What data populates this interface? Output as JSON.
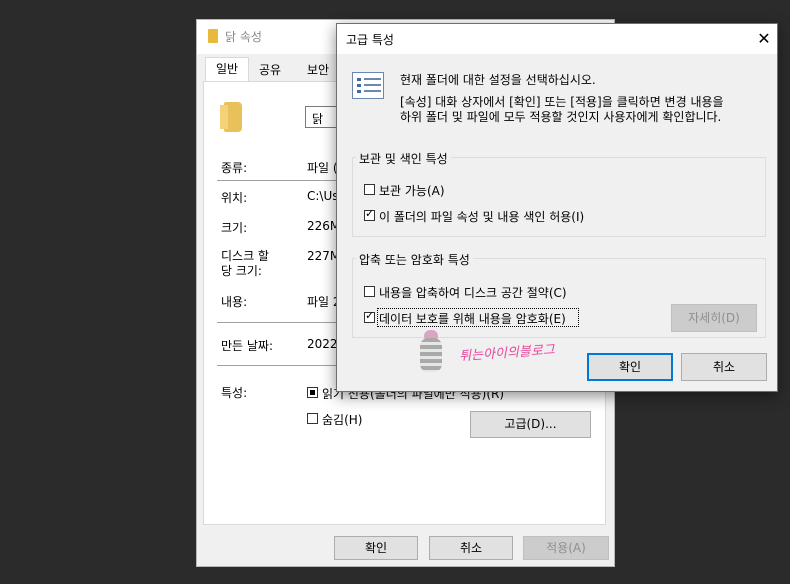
{
  "properties_window": {
    "title": "닭 속성",
    "tabs": [
      "일반",
      "공유",
      "보안"
    ],
    "folder_name": "닭",
    "rows": [
      {
        "label": "종류:",
        "value": "파일 ("
      },
      {
        "label": "위치:",
        "value": "C:\\Us"
      },
      {
        "label": "크기:",
        "value": "226M"
      },
      {
        "label": "디스크 할\n당 크기:",
        "value": "227M"
      },
      {
        "label": "내용:",
        "value": "파일 2"
      },
      {
        "label": "만든 날짜:",
        "value": "2022"
      }
    ],
    "attributes_label": "특성:",
    "readonly_label": "읽기 전용(폴더의 파일에만 적용)(R)",
    "hidden_label": "숨김(H)",
    "advanced_button": "고급(D)...",
    "ok_button": "확인",
    "cancel_button": "취소",
    "apply_button": "적용(A)"
  },
  "advanced_dialog": {
    "title": "고급 특성",
    "close_symbol": "✕",
    "intro": "현재 폴더에 대한 설정을 선택하십시오.",
    "desc_line1": "[속성] 대화 상자에서 [확인] 또는 [적용]을 클릭하면 변경 내용을",
    "desc_line2": "하위 폴더 및 파일에 모두 적용할 것인지 사용자에게 확인합니다.",
    "archive_group": {
      "title": "보관 및 색인 특성",
      "archive_label": "보관 가능(A)",
      "archive_checked": false,
      "index_label": "이 폴더의 파일 속성 및 내용 색인 허용(I)",
      "index_checked": true
    },
    "compress_group": {
      "title": "압축 또는 암호화 특성",
      "compress_label": "내용을 압축하여 디스크 공간 절약(C)",
      "compress_checked": false,
      "encrypt_label": "데이터 보호를 위해 내용을 암호화(E)",
      "encrypt_checked": true,
      "details_button": "자세히(D)"
    },
    "ok_button": "확인",
    "cancel_button": "취소"
  },
  "watermark": "튀는아이의블로그",
  "icons": {
    "folder": "folder-icon",
    "properties": "properties-list-icon",
    "close": "close-icon",
    "mascot": "mascot-icon"
  },
  "colors": {
    "accent": "#0078d7",
    "folder": "#e8c15a",
    "watermark": "#e8479a"
  }
}
